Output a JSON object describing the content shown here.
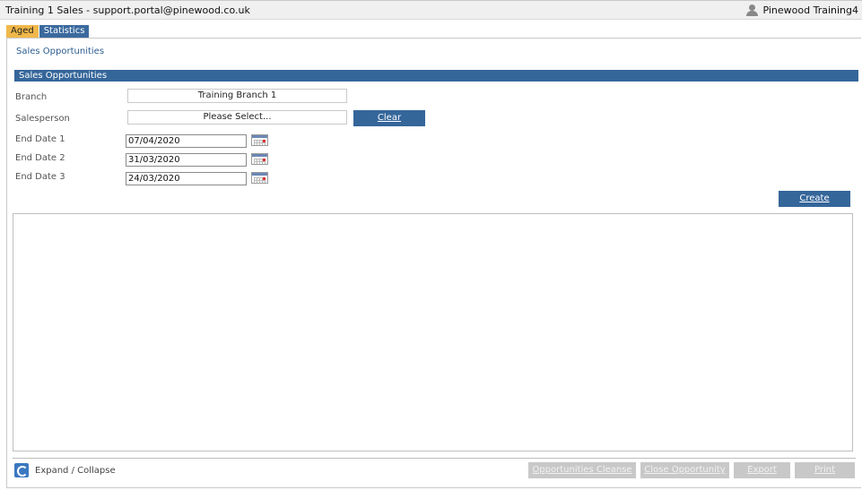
{
  "window": {
    "title": "Training 1 Sales - support.portal@pinewood.co.uk",
    "user": "Pinewood Training4"
  },
  "tabs": [
    {
      "label": "Aged",
      "active": true,
      "color": "#f0b84a"
    },
    {
      "label": "Statistics",
      "active": false,
      "color": "#3a6a9e"
    }
  ],
  "page": {
    "heading": "Sales Opportunities",
    "section_title": "Sales Opportunities"
  },
  "form": {
    "branch_label": "Branch",
    "branch_value": "Training Branch 1",
    "salesperson_label": "Salesperson",
    "salesperson_value": "Please Select...",
    "clear_label": "Clear",
    "end_date_1_label": "End Date 1",
    "end_date_1_value": "07/04/2020",
    "end_date_2_label": "End Date 2",
    "end_date_2_value": "31/03/2020",
    "end_date_3_label": "End Date 3",
    "end_date_3_value": "24/03/2020",
    "create_label": "Create"
  },
  "footer": {
    "expand_label": "Expand / Collapse",
    "buttons": [
      {
        "label": "Opportunities Cleanse",
        "enabled": false
      },
      {
        "label": "Close Opportunity",
        "enabled": false
      },
      {
        "label": "Export",
        "enabled": false
      },
      {
        "label": "Print",
        "enabled": false
      }
    ]
  },
  "colors": {
    "accent": "#35669a",
    "aged_tab": "#f0b84a",
    "disabled_button": "#c8c8c8"
  }
}
